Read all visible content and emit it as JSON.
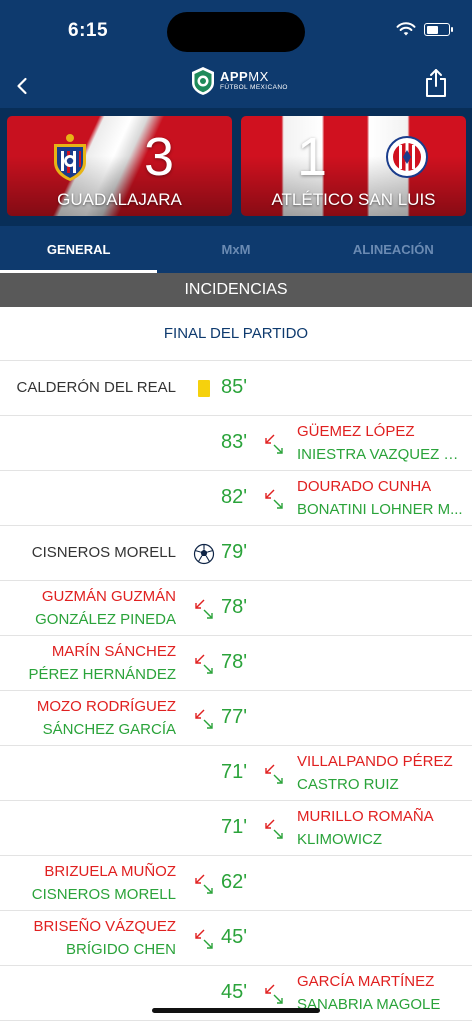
{
  "status_bar": {
    "time": "6:15"
  },
  "header": {
    "logo_main": "APP",
    "logo_thin": "MX",
    "logo_sub": "FÚTBOL MEXICANO"
  },
  "match": {
    "home": {
      "name": "GUADALAJARA",
      "score": "3"
    },
    "away": {
      "name": "ATLÉTICO SAN LUIS",
      "score": "1"
    }
  },
  "tabs": [
    {
      "label": "GENERAL",
      "active": true
    },
    {
      "label": "MxM",
      "active": false
    },
    {
      "label": "ALINEACIÓN",
      "active": false
    }
  ],
  "section_title": "INCIDENCIAS",
  "match_status": "FINAL DEL PARTIDO",
  "events": [
    {
      "type": "card",
      "side": "home",
      "minute": "85'",
      "player": "CALDERÓN DEL REAL"
    },
    {
      "type": "sub",
      "side": "away",
      "minute": "83'",
      "in": "GÜEMEZ LÓPEZ",
      "out": "INIESTRA VAZQUEZ M..."
    },
    {
      "type": "sub",
      "side": "away",
      "minute": "82'",
      "in": "DOURADO CUNHA",
      "out": "BONATINI LOHNER M..."
    },
    {
      "type": "goal",
      "side": "home",
      "minute": "79'",
      "player": "CISNEROS MORELL"
    },
    {
      "type": "sub",
      "side": "home",
      "minute": "78'",
      "in": "GUZMÁN GUZMÁN",
      "out": "GONZÁLEZ PINEDA"
    },
    {
      "type": "sub",
      "side": "home",
      "minute": "78'",
      "in": "MARÍN SÁNCHEZ",
      "out": "PÉREZ HERNÁNDEZ"
    },
    {
      "type": "sub",
      "side": "home",
      "minute": "77'",
      "in": "MOZO RODRÍGUEZ",
      "out": "SÁNCHEZ GARCÍA"
    },
    {
      "type": "sub",
      "side": "away",
      "minute": "71'",
      "in": "VILLALPANDO PÉREZ",
      "out": "CASTRO RUIZ"
    },
    {
      "type": "sub",
      "side": "away",
      "minute": "71'",
      "in": "MURILLO ROMAÑA",
      "out": "KLIMOWICZ"
    },
    {
      "type": "sub",
      "side": "home",
      "minute": "62'",
      "in": "BRIZUELA MUÑOZ",
      "out": "CISNEROS MORELL"
    },
    {
      "type": "sub",
      "side": "home",
      "minute": "45'",
      "in": "BRISEÑO VÁZQUEZ",
      "out": "BRÍGIDO CHEN"
    },
    {
      "type": "sub",
      "side": "away",
      "minute": "45'",
      "in": "GARCÍA MARTÍNEZ",
      "out": "SANABRIA MAGOLE"
    }
  ],
  "colors": {
    "header_blue": "#0e3a6e",
    "sub_in_red": "#e02020",
    "sub_out_green": "#2aa33a",
    "yellow_card": "#f5d10d"
  }
}
